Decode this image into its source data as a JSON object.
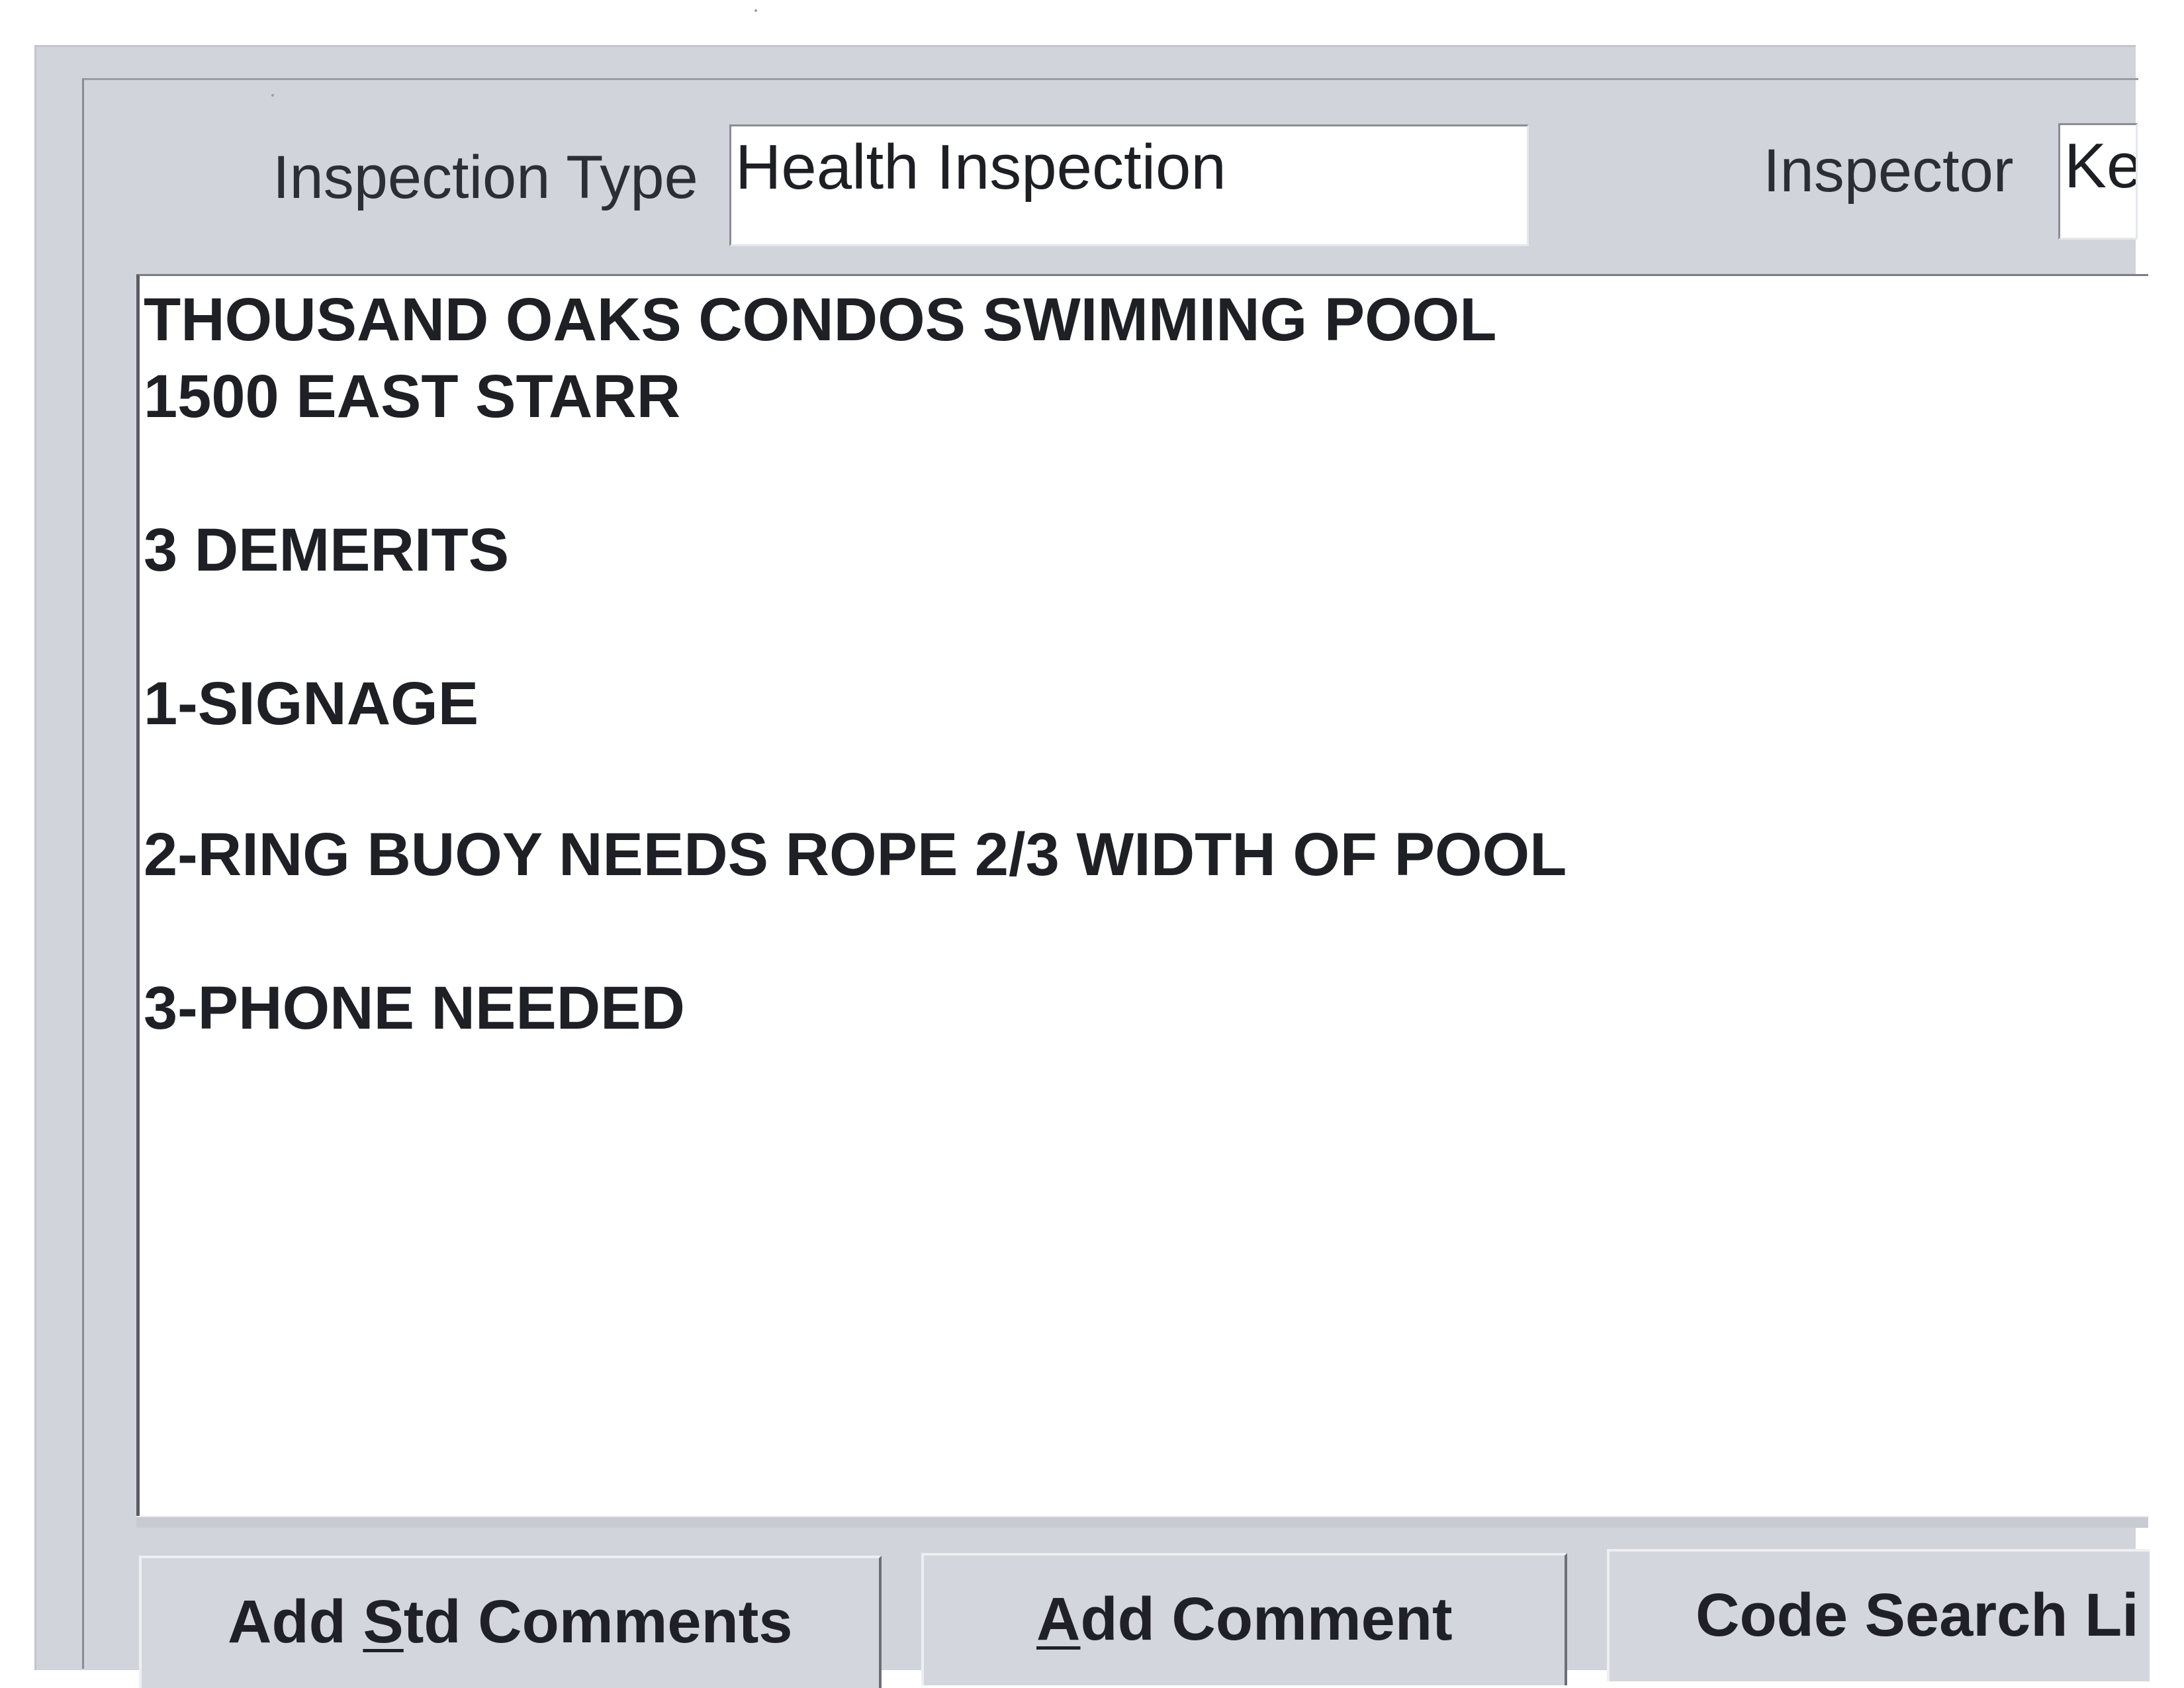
{
  "header": {
    "inspection_type_label": "Inspection Type",
    "inspection_type_value": "Health Inspection",
    "inspector_label": "Inspector",
    "inspector_value": "Ke"
  },
  "notes": {
    "lines": [
      "THOUSAND OAKS CONDOS SWIMMING POOL",
      "1500 EAST STARR",
      "3 DEMERITS",
      "1-SIGNAGE",
      "2-RING BUOY NEEDS ROPE 2/3 WIDTH OF POOL",
      "3-PHONE NEEDED"
    ]
  },
  "buttons": {
    "add_std_comments": {
      "pre": "Add ",
      "mnemonic": "S",
      "post": "td Comments"
    },
    "add_comment": {
      "pre": "",
      "mnemonic": "A",
      "post": "dd Comment"
    },
    "code_search": {
      "pre": "Code Search Li",
      "mnemonic": "",
      "post": ""
    }
  },
  "colors": {
    "window_bg": "#d2d4dc",
    "field_bg": "#ffffff",
    "text": "#1f2026"
  }
}
